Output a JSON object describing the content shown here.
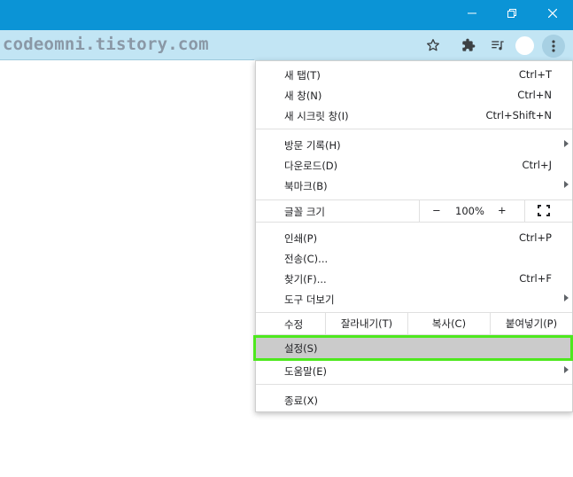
{
  "titlebar": {
    "color": "#0b94d6",
    "buttons": {
      "minimize_icon": "minimize-icon",
      "restore_icon": "restore-icon",
      "close_icon": "close-icon"
    }
  },
  "toolbar": {
    "url": "codeomni.tistory.com",
    "icons": [
      "star-icon",
      "extensions-puzzle-icon",
      "media-playlist-icon",
      "profile-avatar",
      "more-menu-icon"
    ]
  },
  "menu": {
    "new_tab": {
      "label": "새 탭(T)",
      "shortcut": "Ctrl+T"
    },
    "new_window": {
      "label": "새 창(N)",
      "shortcut": "Ctrl+N"
    },
    "new_incognito": {
      "label": "새 시크릿 창(I)",
      "shortcut": "Ctrl+Shift+N"
    },
    "history": {
      "label": "방문 기록(H)"
    },
    "downloads": {
      "label": "다운로드(D)",
      "shortcut": "Ctrl+J"
    },
    "bookmarks": {
      "label": "북마크(B)"
    },
    "zoom": {
      "label": "글꼴 크기",
      "minus": "−",
      "value": "100%",
      "plus": "+"
    },
    "print": {
      "label": "인쇄(P)",
      "shortcut": "Ctrl+P"
    },
    "cast": {
      "label": "전송(C)..."
    },
    "find": {
      "label": "찾기(F)...",
      "shortcut": "Ctrl+F"
    },
    "more_tools": {
      "label": "도구 더보기"
    },
    "edit": {
      "label": "수정",
      "cut": "잘라내기(T)",
      "copy": "복사(C)",
      "paste": "붙여넣기(P)"
    },
    "settings": {
      "label": "설정(S)",
      "highlight_color": "#4ee81e"
    },
    "help": {
      "label": "도움말(E)"
    },
    "exit": {
      "label": "종료(X)"
    }
  }
}
